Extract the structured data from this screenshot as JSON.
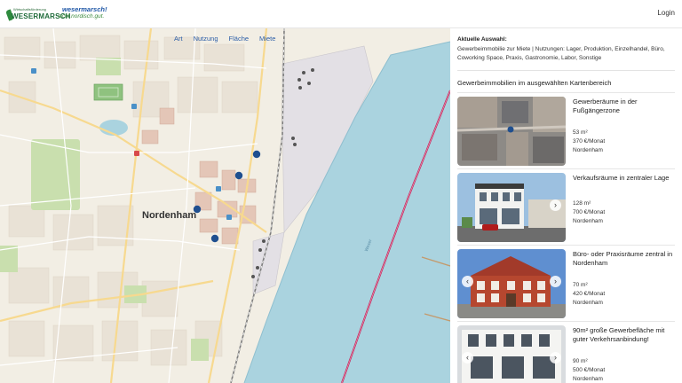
{
  "header": {
    "logo_small": "Wirtschaftsförderung",
    "logo_big": "WESERMARSCH",
    "logo_slogan_1": "wesermarsch!",
    "logo_slogan_2": "echt.nordisch.gut.",
    "login_label": "Login"
  },
  "map": {
    "filters": [
      "Art",
      "Nutzung",
      "Fläche",
      "Miete"
    ],
    "town_label": "Nordenham",
    "river_label_1": "Weser",
    "marker_color": "#1f4f8f",
    "route_color": "#c0245a"
  },
  "panel": {
    "selection_title": "Aktuelle Auswahl:",
    "selection_text": "Gewerbeimmobilie zur Miete | Nutzungen: Lager, Produktion, Einzelhandel, Büro, Coworking Space, Praxis, Gastronomie, Labor, Sonstige",
    "list_title": "Gewerbeimmobilien im ausgewählten Kartenbereich",
    "listings": [
      {
        "title": "Gewerberäume in der Fußgängerzone",
        "area": "53 m²",
        "rent": "370 €/Monat",
        "town": "Nordenham"
      },
      {
        "title": "Verkaufsräume in zentraler Lage",
        "area": "128 m²",
        "rent": "700 €/Monat",
        "town": "Nordenham"
      },
      {
        "title": "Büro- oder Praxisräume zentral in Nordenham",
        "area": "70 m²",
        "rent": "420 €/Monat",
        "town": "Nordenham"
      },
      {
        "title": "90m² große Gewerbefläche mit guter Verkehrsanbindung!",
        "area": "90 m²",
        "rent": "500 €/Monat",
        "town": "Nordenham"
      }
    ]
  },
  "icons": {
    "prev": "‹",
    "next": "›"
  }
}
